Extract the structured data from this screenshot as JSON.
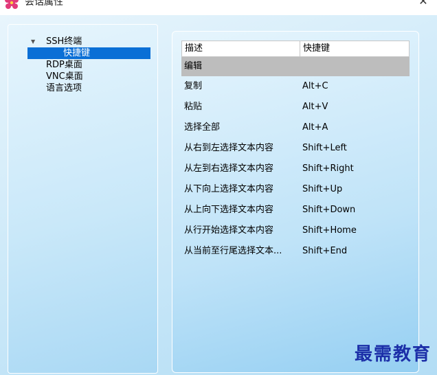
{
  "window": {
    "title": "会话属性",
    "close_glyph": "✕",
    "icon": "app-logo-icon"
  },
  "tree": {
    "items": [
      {
        "label": "SSH终端",
        "expanded": true,
        "level": 0
      },
      {
        "label": "快捷键",
        "selected": true,
        "level": 1
      },
      {
        "label": "RDP桌面",
        "level": 0
      },
      {
        "label": "VNC桌面",
        "level": 0
      },
      {
        "label": "语言选项",
        "level": 0
      }
    ],
    "expander_glyph": "▼"
  },
  "shortcuts": {
    "columns": [
      "描述",
      "快捷键"
    ],
    "group": "编辑",
    "rows": [
      {
        "desc": "复制",
        "key": "Alt+C"
      },
      {
        "desc": "粘贴",
        "key": "Alt+V"
      },
      {
        "desc": "选择全部",
        "key": "Alt+A"
      },
      {
        "desc": "从右到左选择文本内容",
        "key": "Shift+Left"
      },
      {
        "desc": "从左到右选择文本内容",
        "key": "Shift+Right"
      },
      {
        "desc": "从下向上选择文本内容",
        "key": "Shift+Up"
      },
      {
        "desc": "从上向下选择文本内容",
        "key": "Shift+Down"
      },
      {
        "desc": "从行开始选择文本内容",
        "key": "Shift+Home"
      },
      {
        "desc": "从当前至行尾选择文本...",
        "key": "Shift+End"
      }
    ]
  },
  "watermark": "最需教育",
  "colors": {
    "selection": "#0a6fd6",
    "group_row": "#bdbdbd",
    "watermark": "#1c2fa8",
    "logo": "#e23a7a"
  }
}
